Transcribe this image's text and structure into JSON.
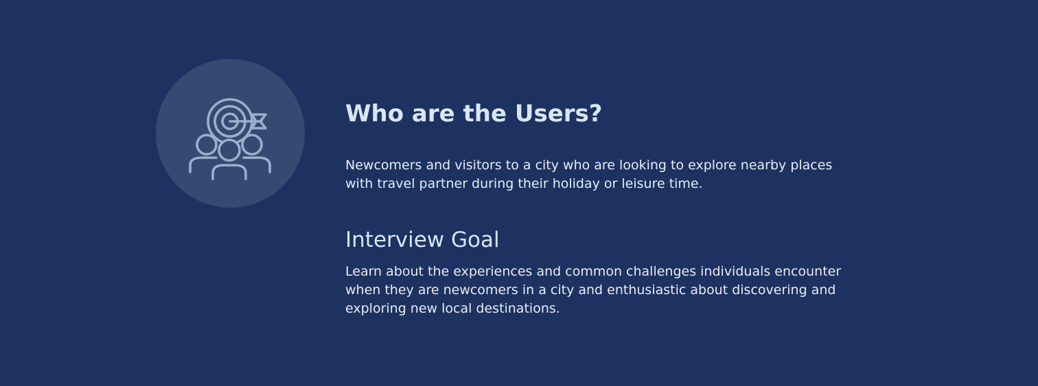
{
  "icon": {
    "name": "target-users-icon",
    "stroke_color": "#9eaecb",
    "circle_color": "#354a72"
  },
  "colors": {
    "background": "#1d3260",
    "heading": "#d8e6f6",
    "body_text": "#e7edf6"
  },
  "users": {
    "title": "Who are the Users?",
    "description": "Newcomers and visitors to a city who are looking to explore nearby places with travel partner during their holiday or leisure time."
  },
  "interview": {
    "title": "Interview Goal",
    "description": "Learn about the experiences and common challenges individuals encounter when they are newcomers in a city and enthusiastic about discovering and exploring new local destinations."
  }
}
